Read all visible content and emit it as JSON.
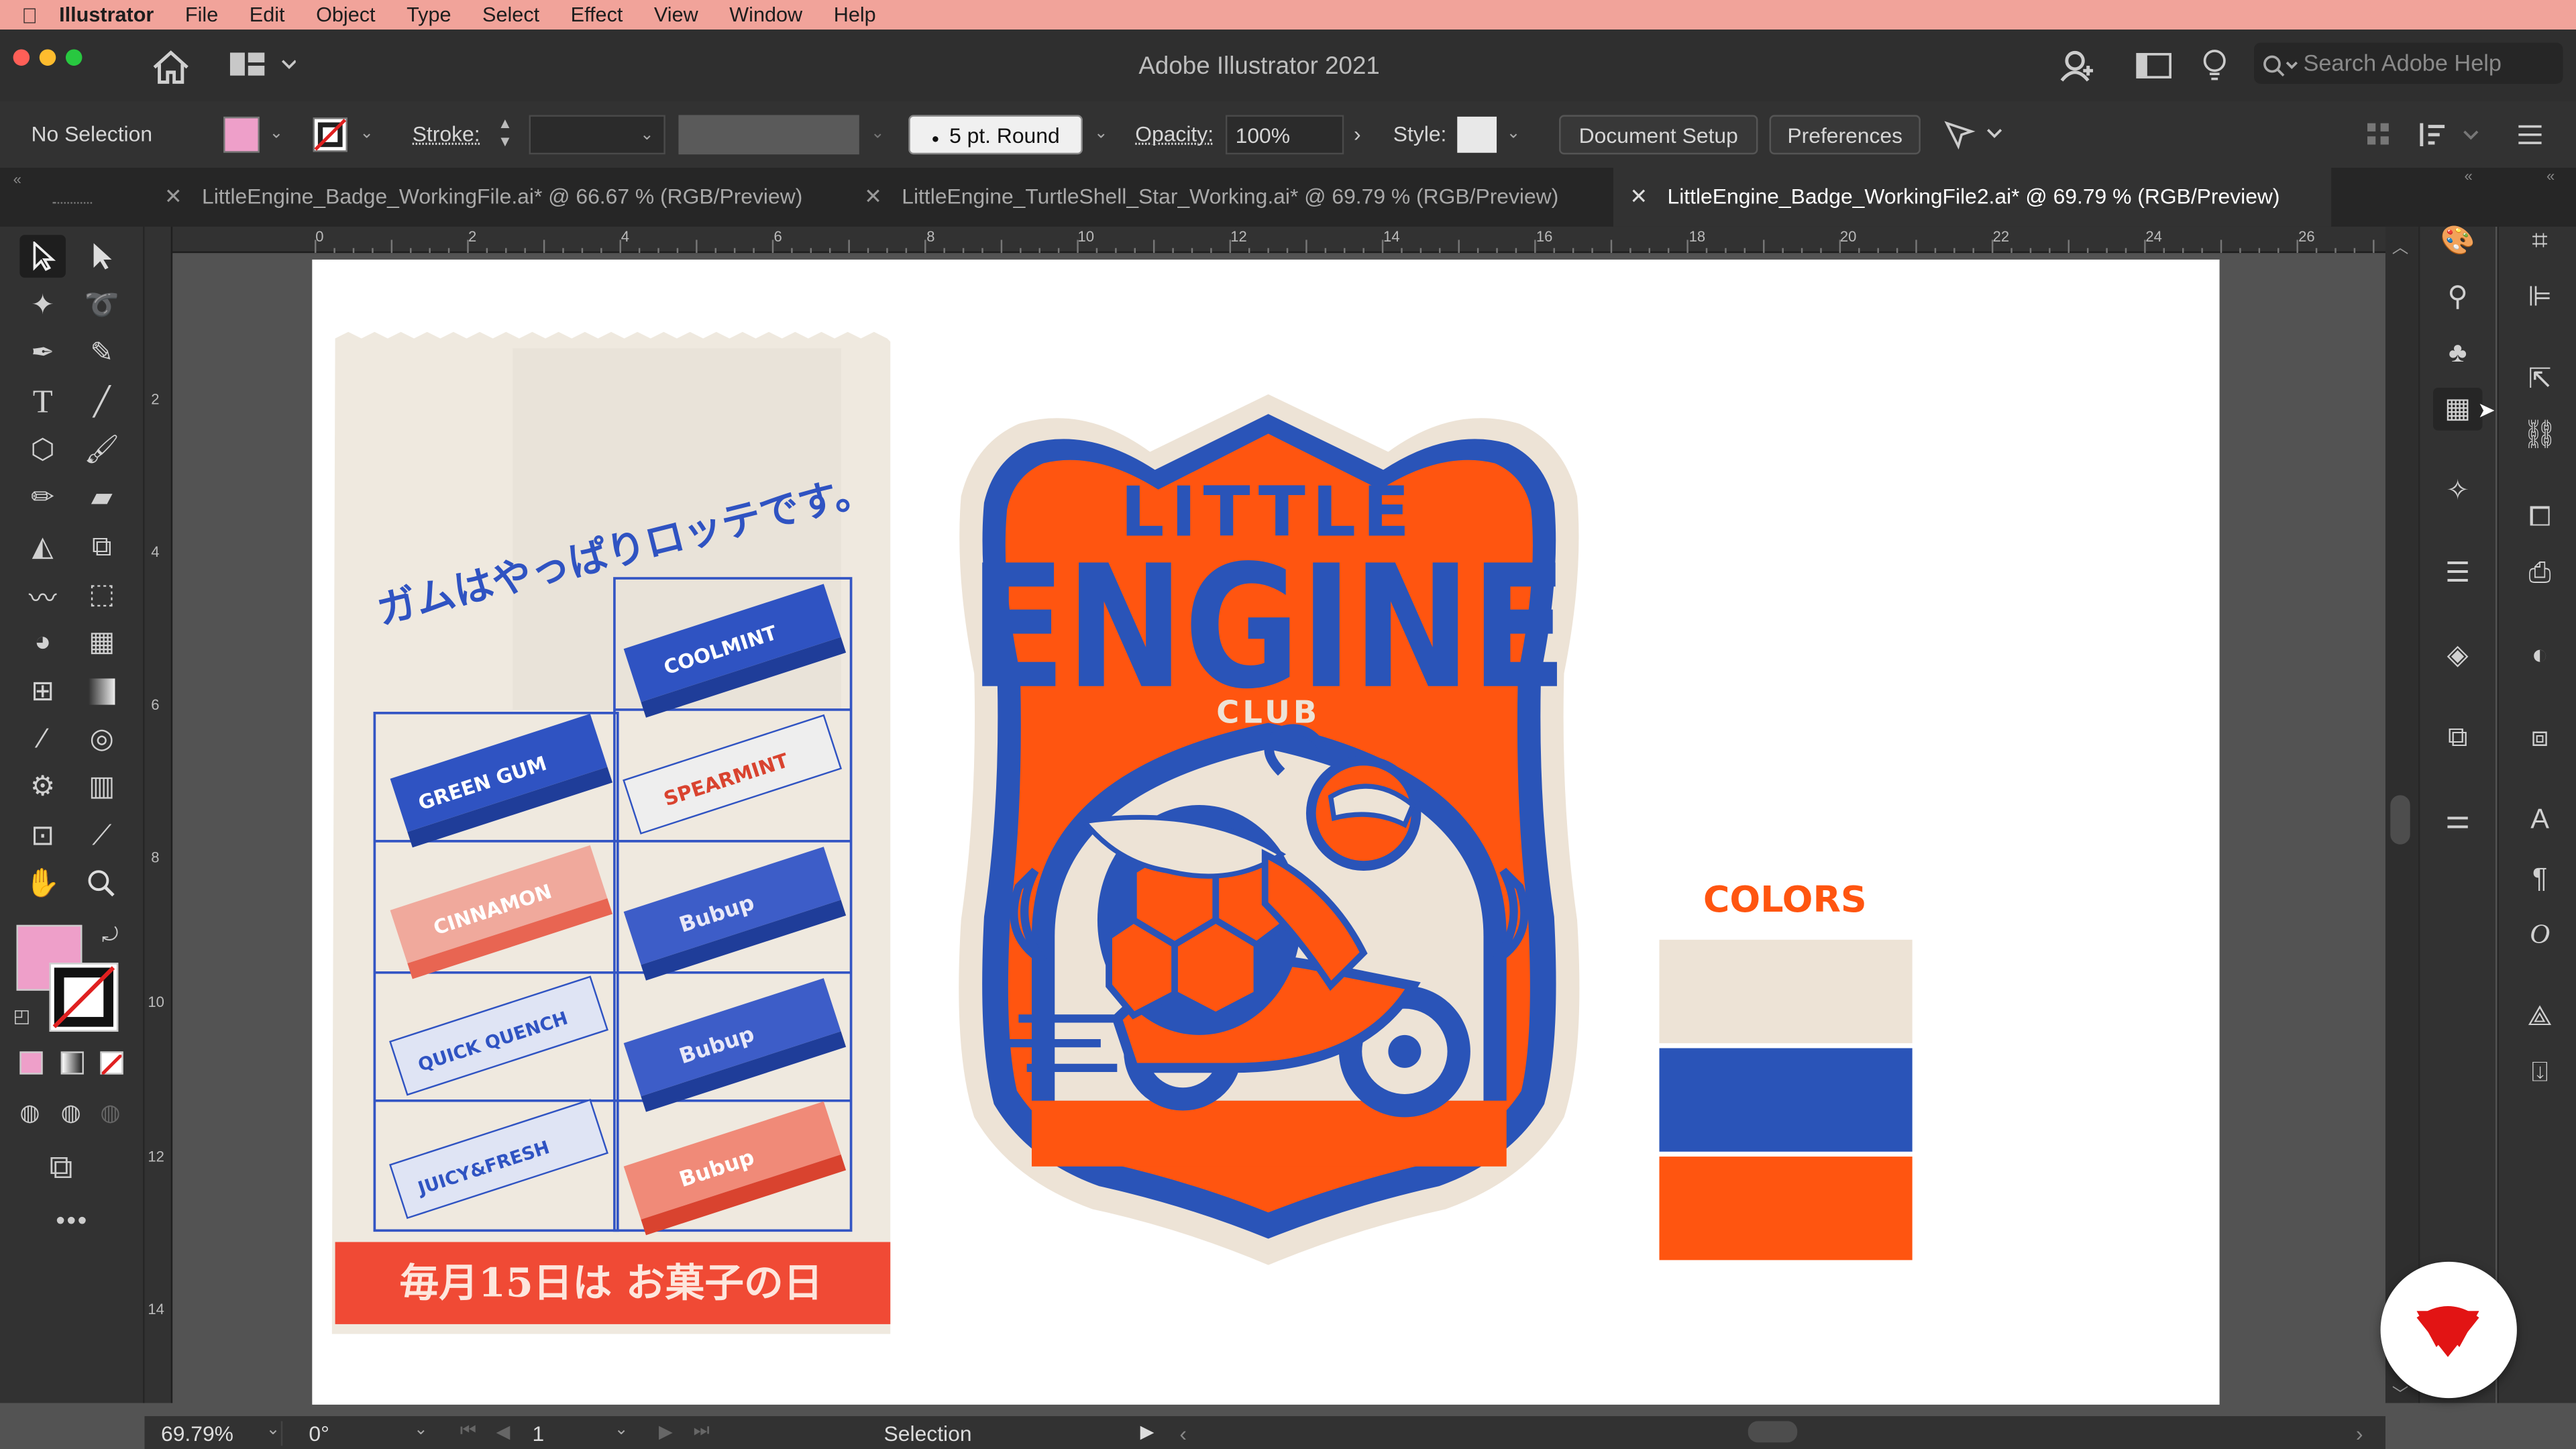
{
  "menubar": {
    "app": "Illustrator",
    "items": [
      "File",
      "Edit",
      "Object",
      "Type",
      "Select",
      "Effect",
      "View",
      "Window",
      "Help"
    ]
  },
  "window": {
    "title": "Adobe Illustrator 2021",
    "search_placeholder": "Search Adobe Help"
  },
  "control": {
    "selection": "No Selection",
    "stroke_label": "Stroke:",
    "brush": "5 pt. Round",
    "opacity_label": "Opacity:",
    "opacity_value": "100%",
    "style_label": "Style:",
    "doc_setup": "Document Setup",
    "preferences": "Preferences",
    "fill_color": "#ee9fc9"
  },
  "tabs": [
    {
      "label": "LittleEngine_Badge_WorkingFile.ai* @ 66.67 % (RGB/Preview)",
      "active": false
    },
    {
      "label": "LittleEngine_TurtleShell_Star_Working.ai* @ 69.79 % (RGB/Preview)",
      "active": false
    },
    {
      "label": "LittleEngine_Badge_WorkingFile2.ai* @ 69.79 % (RGB/Preview)",
      "active": true
    }
  ],
  "ruler": {
    "top": [
      "0",
      "2",
      "4",
      "6",
      "8",
      "10",
      "12",
      "14",
      "16",
      "18",
      "20",
      "22",
      "24",
      "26"
    ],
    "left": [
      "2",
      "4",
      "6",
      "8",
      "10",
      "12",
      "14"
    ]
  },
  "artwork": {
    "japanese_headline": "ガムはやっぱりロッテです。",
    "japanese_footer": "毎月15日は お菓子の日",
    "badge_line1": "LITTLE",
    "badge_line2": "ENGINE",
    "badge_line3": "CLUB",
    "colors_title": "COLORS",
    "swatches": [
      "#ede3d6",
      "#2a54b8",
      "#ff5510"
    ]
  },
  "status": {
    "zoom": "69.79%",
    "rotation": "0°",
    "artboard": "1",
    "mode": "Selection"
  }
}
